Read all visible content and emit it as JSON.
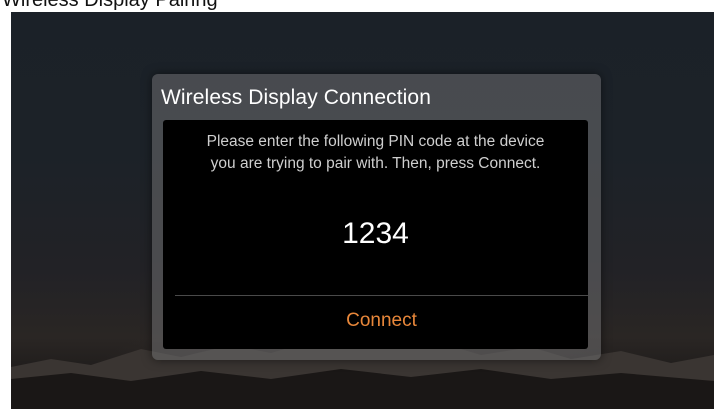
{
  "page_header": {
    "text": "Wireless Display Pairing"
  },
  "dialog": {
    "title": "Wireless Display Connection",
    "message_lines": [
      "Please enter the following PIN code at the device",
      "you are trying to pair with. Then, press Connect."
    ],
    "pin_code": "1234",
    "connect_label": "Connect"
  },
  "colors": {
    "accent": "#e8873a",
    "dialog_background": "#000000",
    "text_primary": "#ffffff",
    "text_secondary": "#cfcfcf"
  }
}
